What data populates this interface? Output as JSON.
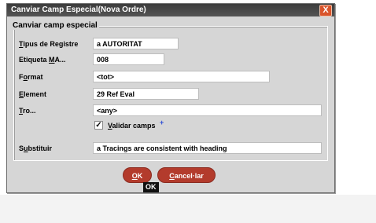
{
  "window": {
    "title": "Canviar Camp Especial(Nova Ordre)",
    "close_glyph": "X"
  },
  "group": {
    "legend": "Canviar camp especial"
  },
  "fields": {
    "tipus_registre": {
      "label_u": "T",
      "label_rest": "ipus de Registre",
      "value": "a  AUTORITAT"
    },
    "etiqueta": {
      "label_pre": "Etiqueta ",
      "label_u": "M",
      "label_rest": "A...",
      "value": "008"
    },
    "format": {
      "label_pre": "F",
      "label_u": "o",
      "label_rest": "rmat",
      "value": "<tot>"
    },
    "element": {
      "label_u": "E",
      "label_rest": "lement",
      "value": "29  Ref Eval"
    },
    "tro": {
      "label_u": "T",
      "label_rest": "ro...",
      "value": "<any>"
    },
    "substituir": {
      "label_pre": "S",
      "label_u": "u",
      "label_rest": "bstituir",
      "value": "a Tracings are consistent with heading"
    }
  },
  "validar": {
    "checked_glyph": "✓",
    "label_u": "V",
    "label_rest": "alidar camps"
  },
  "cursor_glyph": "+",
  "buttons": {
    "ok_u": "O",
    "ok_rest": "K",
    "cancel_u": "C",
    "cancel_rest": "ancel·lar"
  },
  "tooltip": {
    "text": "OK"
  },
  "colors": {
    "button": "#b33b2c",
    "close": "#d9542b",
    "titlebar": "#3c3c3c"
  }
}
